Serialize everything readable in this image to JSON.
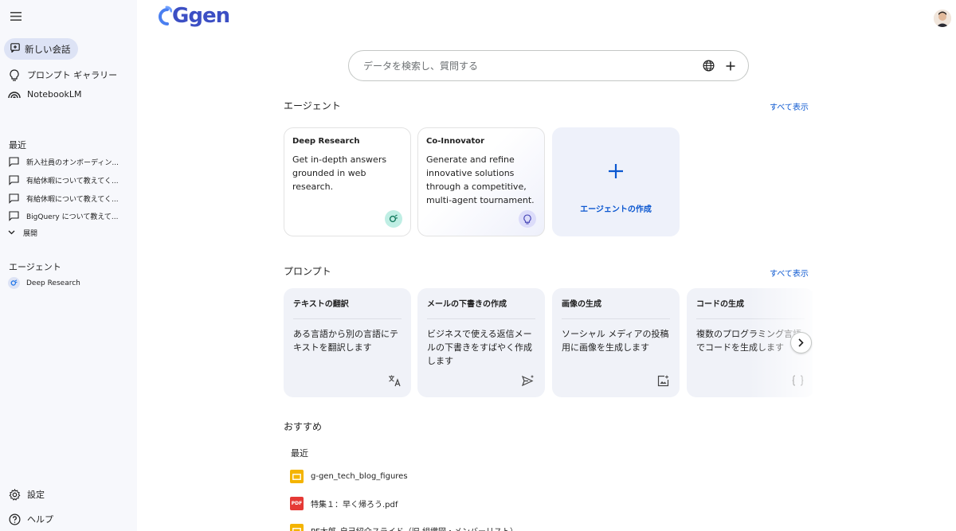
{
  "sidebar": {
    "new_chat": "新しい会話",
    "nav": [
      {
        "label": "プロンプト ギャラリー"
      },
      {
        "label": "NotebookLM"
      }
    ],
    "recent_label": "最近",
    "recent": [
      {
        "label": "新入社員のオンボーディン..."
      },
      {
        "label": "有給休暇について教えてく..."
      },
      {
        "label": "有給休暇について教えてく..."
      },
      {
        "label": "BigQuery について教えて..."
      }
    ],
    "expand": "展開",
    "agents_label": "エージェント",
    "agents": [
      {
        "label": "Deep Research"
      }
    ],
    "settings": "設定",
    "help": "ヘルプ"
  },
  "header": {
    "logo": "Ggen"
  },
  "search": {
    "placeholder": "データを検索し、質問する",
    "value": ""
  },
  "agents_section": {
    "title": "エージェント",
    "see_all": "すべて表示",
    "cards": [
      {
        "title": "Deep Research",
        "desc": "Get in-depth answers grounded in web research."
      },
      {
        "title": "Co-Innovator",
        "desc": "Generate and refine innovative solutions through a competitive, multi-agent tournament."
      }
    ],
    "create_label": "エージェントの作成"
  },
  "prompts_section": {
    "title": "プロンプト",
    "see_all": "すべて表示",
    "cards": [
      {
        "title": "テキストの翻訳",
        "desc": "ある言語から別の言語にテキストを翻訳します"
      },
      {
        "title": "メールの下書きの作成",
        "desc": "ビジネスで使える返信メールの下書きをすばやく作成します"
      },
      {
        "title": "画像の生成",
        "desc": "ソーシャル メディアの投稿用に画像を生成します"
      },
      {
        "title": "コードの生成",
        "desc": "複数のプログラミング言語でコードを生成します"
      }
    ]
  },
  "recommend": {
    "title": "おすすめ",
    "recent_label": "最近",
    "files": [
      {
        "name": "g-gen_tech_blog_figures",
        "type": "slides"
      },
      {
        "name": "特集１：早く帰ろう.pdf",
        "type": "pdf"
      },
      {
        "name": "PF太郎_自己紹介スライド（旧 組織図・メンバーリスト）",
        "type": "slides"
      }
    ]
  },
  "colors": {
    "accent": "#0b57d0",
    "logo": "#3c4fc4",
    "sidebar_bg": "#f7f8fc",
    "new_chat_bg": "#dde3f5",
    "slides": "#f4b400",
    "pdf": "#e53935"
  }
}
